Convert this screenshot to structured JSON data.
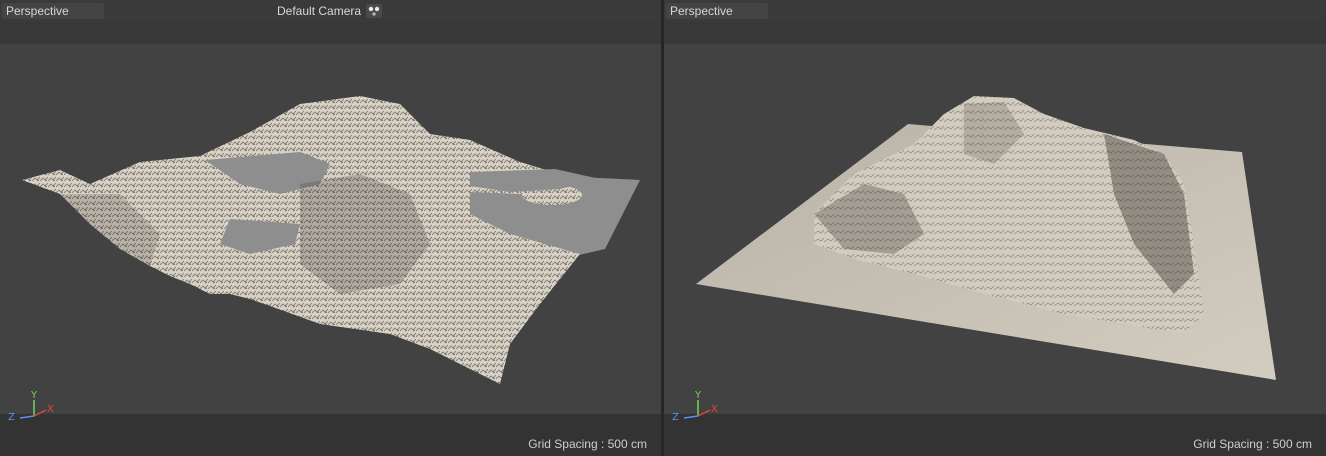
{
  "viewports": [
    {
      "id": "left",
      "view_mode": "Perspective",
      "camera_label": "Default Camera",
      "grid_spacing": "Grid Spacing : 500 cm",
      "axes": {
        "x": "X",
        "y": "Y",
        "z": "Z"
      }
    },
    {
      "id": "right",
      "view_mode": "Perspective",
      "grid_spacing": "Grid Spacing : 500 cm",
      "axes": {
        "x": "X",
        "y": "Y",
        "z": "Z"
      }
    }
  ],
  "colors": {
    "axis_x": "#e0473f",
    "axis_y": "#6fd35a",
    "axis_z": "#5b8cf0",
    "terrain_light": "#ddd6cb",
    "water_plane": "#8e8e8e"
  },
  "icons": {
    "camera": "camera-icon"
  }
}
